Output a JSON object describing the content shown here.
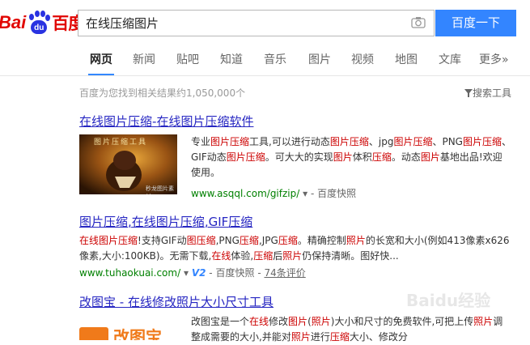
{
  "logo": {
    "text_latin": "Bai",
    "text_du": "du",
    "text_cn": "百度"
  },
  "search": {
    "value": "在线压缩图片",
    "button_label": "百度一下"
  },
  "nav": {
    "tabs": [
      {
        "label": "网页",
        "active": true
      },
      {
        "label": "新闻"
      },
      {
        "label": "贴吧"
      },
      {
        "label": "知道"
      },
      {
        "label": "音乐"
      },
      {
        "label": "图片"
      },
      {
        "label": "视频"
      },
      {
        "label": "地图"
      },
      {
        "label": "文库"
      },
      {
        "label": "更多»"
      }
    ]
  },
  "stats": "百度为您找到相关结果约1,050,000个",
  "tools": "搜索工具",
  "results": [
    {
      "title_parts": [
        {
          "t": "在线图片压缩",
          "em": false
        },
        {
          "t": "-",
          "em": false
        },
        {
          "t": "在线图片压缩",
          "em": false
        },
        {
          "t": "软件",
          "em": false
        }
      ],
      "thumb_caption": "图片压缩工具",
      "thumb_credit": "秒龙图片素材",
      "abstract": [
        {
          "t": "专业",
          "em": false
        },
        {
          "t": "图片压缩",
          "em": true
        },
        {
          "t": "工具,可以进行动态",
          "em": false
        },
        {
          "t": "图片压缩",
          "em": true
        },
        {
          "t": "、jpg",
          "em": false
        },
        {
          "t": "图片压缩",
          "em": true
        },
        {
          "t": "、PNG",
          "em": false
        },
        {
          "t": "图片压缩",
          "em": true
        },
        {
          "t": "、GIF动态",
          "em": false
        },
        {
          "t": "图片压缩",
          "em": true
        },
        {
          "t": "。可大大的实现",
          "em": false
        },
        {
          "t": "图片",
          "em": true
        },
        {
          "t": "体积",
          "em": false
        },
        {
          "t": "压缩",
          "em": true
        },
        {
          "t": "。动态",
          "em": false
        },
        {
          "t": "图片",
          "em": true
        },
        {
          "t": "基地出品!欢迎使用。",
          "em": false
        }
      ],
      "url": "www.asqql.com/gifzip/",
      "cache": "百度快照"
    },
    {
      "title_parts": [
        {
          "t": "图片压缩",
          "em": false
        },
        {
          "t": ",",
          "em": false
        },
        {
          "t": "在线图片压缩",
          "em": false
        },
        {
          "t": ",GIF",
          "em": false
        },
        {
          "t": "压缩",
          "em": false
        }
      ],
      "abstract": [
        {
          "t": "在线图片压缩",
          "em": true
        },
        {
          "t": "!支持GIF动",
          "em": false
        },
        {
          "t": "图压缩",
          "em": true
        },
        {
          "t": ",PNG",
          "em": false
        },
        {
          "t": "压缩",
          "em": true
        },
        {
          "t": ",JPG",
          "em": false
        },
        {
          "t": "压缩",
          "em": true
        },
        {
          "t": "。精确控制",
          "em": false
        },
        {
          "t": "照片",
          "em": true
        },
        {
          "t": "的长宽和大小(例如413像素x626像素,大小:100KB)。无需下载,",
          "em": false
        },
        {
          "t": "在线",
          "em": true
        },
        {
          "t": "体验,",
          "em": false
        },
        {
          "t": "压缩",
          "em": true
        },
        {
          "t": "后",
          "em": false
        },
        {
          "t": "照片",
          "em": true
        },
        {
          "t": "仍保持清晰。图好快...",
          "em": false
        }
      ],
      "url": "www.tuhaokuai.com/",
      "v_badge": "V2",
      "cache": "百度快照",
      "reviews": "74条评价"
    },
    {
      "title_parts": [
        {
          "t": "改图宝",
          "em": false
        },
        {
          "t": " - ",
          "em": false
        },
        {
          "t": "在线",
          "em": false
        },
        {
          "t": "修改",
          "em": false
        },
        {
          "t": "照片",
          "em": false
        },
        {
          "t": "大小尺寸工具",
          "em": false
        }
      ],
      "thumb_caption": "改图宝",
      "abstract": [
        {
          "t": "改图宝是一个",
          "em": false
        },
        {
          "t": "在线",
          "em": true
        },
        {
          "t": "修改",
          "em": false
        },
        {
          "t": "图片",
          "em": true
        },
        {
          "t": "(",
          "em": false
        },
        {
          "t": "照片",
          "em": true
        },
        {
          "t": ")大小和尺寸的免费软件,可把上传",
          "em": false
        },
        {
          "t": "照片",
          "em": true
        },
        {
          "t": "调整成需要的大小,并能对",
          "em": false
        },
        {
          "t": "照片",
          "em": true
        },
        {
          "t": "进行",
          "em": false
        },
        {
          "t": "压缩",
          "em": true
        },
        {
          "t": "大小、修改分",
          "em": false
        }
      ]
    }
  ],
  "watermark": "Baidu经验",
  "colors": {
    "accent": "#3385ff",
    "link": "#2626c2",
    "highlight": "#c00000",
    "url": "#008000"
  }
}
